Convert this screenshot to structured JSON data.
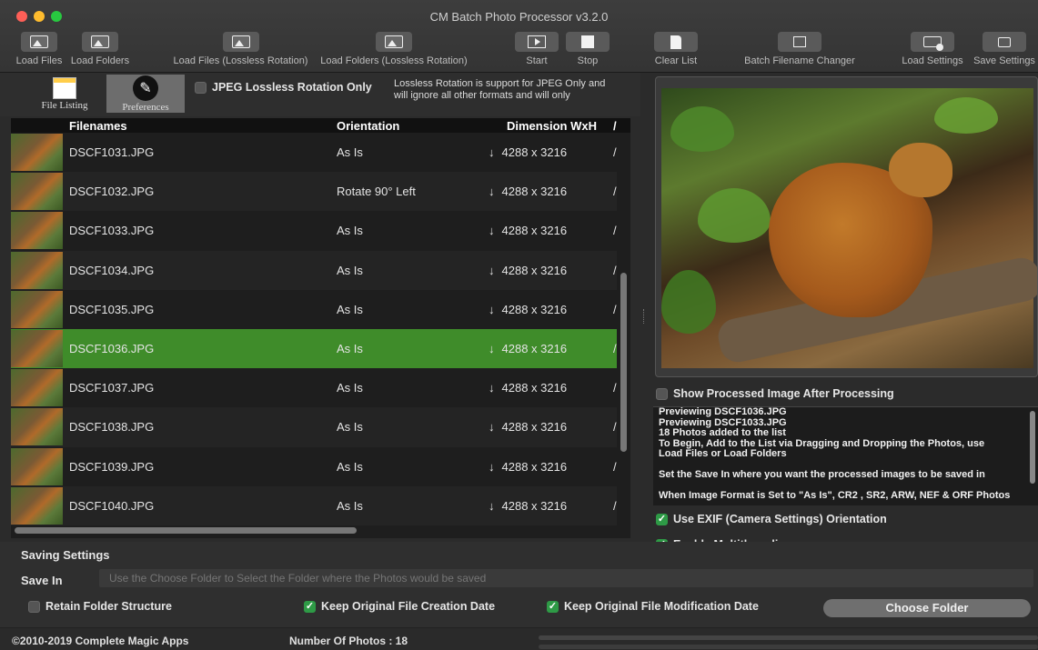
{
  "window": {
    "title": "CM Batch Photo Processor v3.2.0"
  },
  "toolbar": {
    "load_files": "Load Files",
    "load_folders": "Load Folders",
    "load_files_lossless": "Load Files (Lossless Rotation)",
    "load_folders_lossless": "Load Folders (Lossless Rotation)",
    "start": "Start",
    "stop": "Stop",
    "clear_list": "Clear List",
    "batch_renamer": "Batch Filename Changer",
    "load_settings": "Load Settings",
    "save_settings": "Save Settings"
  },
  "modes": {
    "file_listing": "File Listing",
    "preferences": "Preferences"
  },
  "options": {
    "jpeg_lossless_only": "JPEG Lossless Rotation Only",
    "lossless_note": "Lossless Rotation is support for JPEG Only and will ignore all other formats and will only"
  },
  "table": {
    "headers": {
      "filenames": "Filenames",
      "orientation": "Orientation",
      "dimension": "Dimension WxH",
      "extra": "/"
    },
    "rows": [
      {
        "filename": "DSCF1031.JPG",
        "orientation": "As Is",
        "dimension": "4288 x 3216",
        "extra": "/"
      },
      {
        "filename": "DSCF1032.JPG",
        "orientation": "Rotate 90° Left",
        "dimension": "4288 x 3216",
        "extra": "/"
      },
      {
        "filename": "DSCF1033.JPG",
        "orientation": "As Is",
        "dimension": "4288 x 3216",
        "extra": "/"
      },
      {
        "filename": "DSCF1034.JPG",
        "orientation": "As Is",
        "dimension": "4288 x 3216",
        "extra": "/"
      },
      {
        "filename": "DSCF1035.JPG",
        "orientation": "As Is",
        "dimension": "4288 x 3216",
        "extra": "/"
      },
      {
        "filename": "DSCF1036.JPG",
        "orientation": "As Is",
        "dimension": "4288 x 3216",
        "extra": "/",
        "selected": true
      },
      {
        "filename": "DSCF1037.JPG",
        "orientation": "As Is",
        "dimension": "4288 x 3216",
        "extra": "/"
      },
      {
        "filename": "DSCF1038.JPG",
        "orientation": "As Is",
        "dimension": "4288 x 3216",
        "extra": "/"
      },
      {
        "filename": "DSCF1039.JPG",
        "orientation": "As Is",
        "dimension": "4288 x 3216",
        "extra": "/"
      },
      {
        "filename": "DSCF1040.JPG",
        "orientation": "As Is",
        "dimension": "4288 x 3216",
        "extra": "/"
      }
    ]
  },
  "preview": {
    "show_processed": "Show Processed Image After Processing"
  },
  "log": {
    "lines": [
      "Previewing DSCF1036.JPG",
      "Previewing DSCF1033.JPG",
      "18 Photos added to the list",
      "To Begin, Add to the List via Dragging and Dropping the Photos, use",
      "Load Files or Load Folders",
      "",
      "Set the Save In where you want the processed images to be saved in",
      "",
      "When Image Format is Set to \"As Is\", CR2 , SR2, ARW, NEF & ORF Photos"
    ]
  },
  "right_options": {
    "use_exif": "Use EXIF (Camera Settings) Orientation",
    "multithreading": "Enable Multithreading"
  },
  "saving": {
    "title": "Saving Settings",
    "save_in_label": "Save In",
    "save_in_placeholder": "Use the Choose Folder to Select the Folder where the Photos would be saved",
    "retain_structure": "Retain Folder Structure",
    "keep_creation": "Keep Original File Creation Date",
    "keep_modification": "Keep Original File Modification Date",
    "choose_folder": "Choose Folder"
  },
  "footer": {
    "copyright": "©2010-2019 Complete Magic Apps",
    "count": "Number Of Photos : 18"
  },
  "colors": {
    "selected_row": "#3f8c2a",
    "checkbox_on": "#2e9a46"
  }
}
